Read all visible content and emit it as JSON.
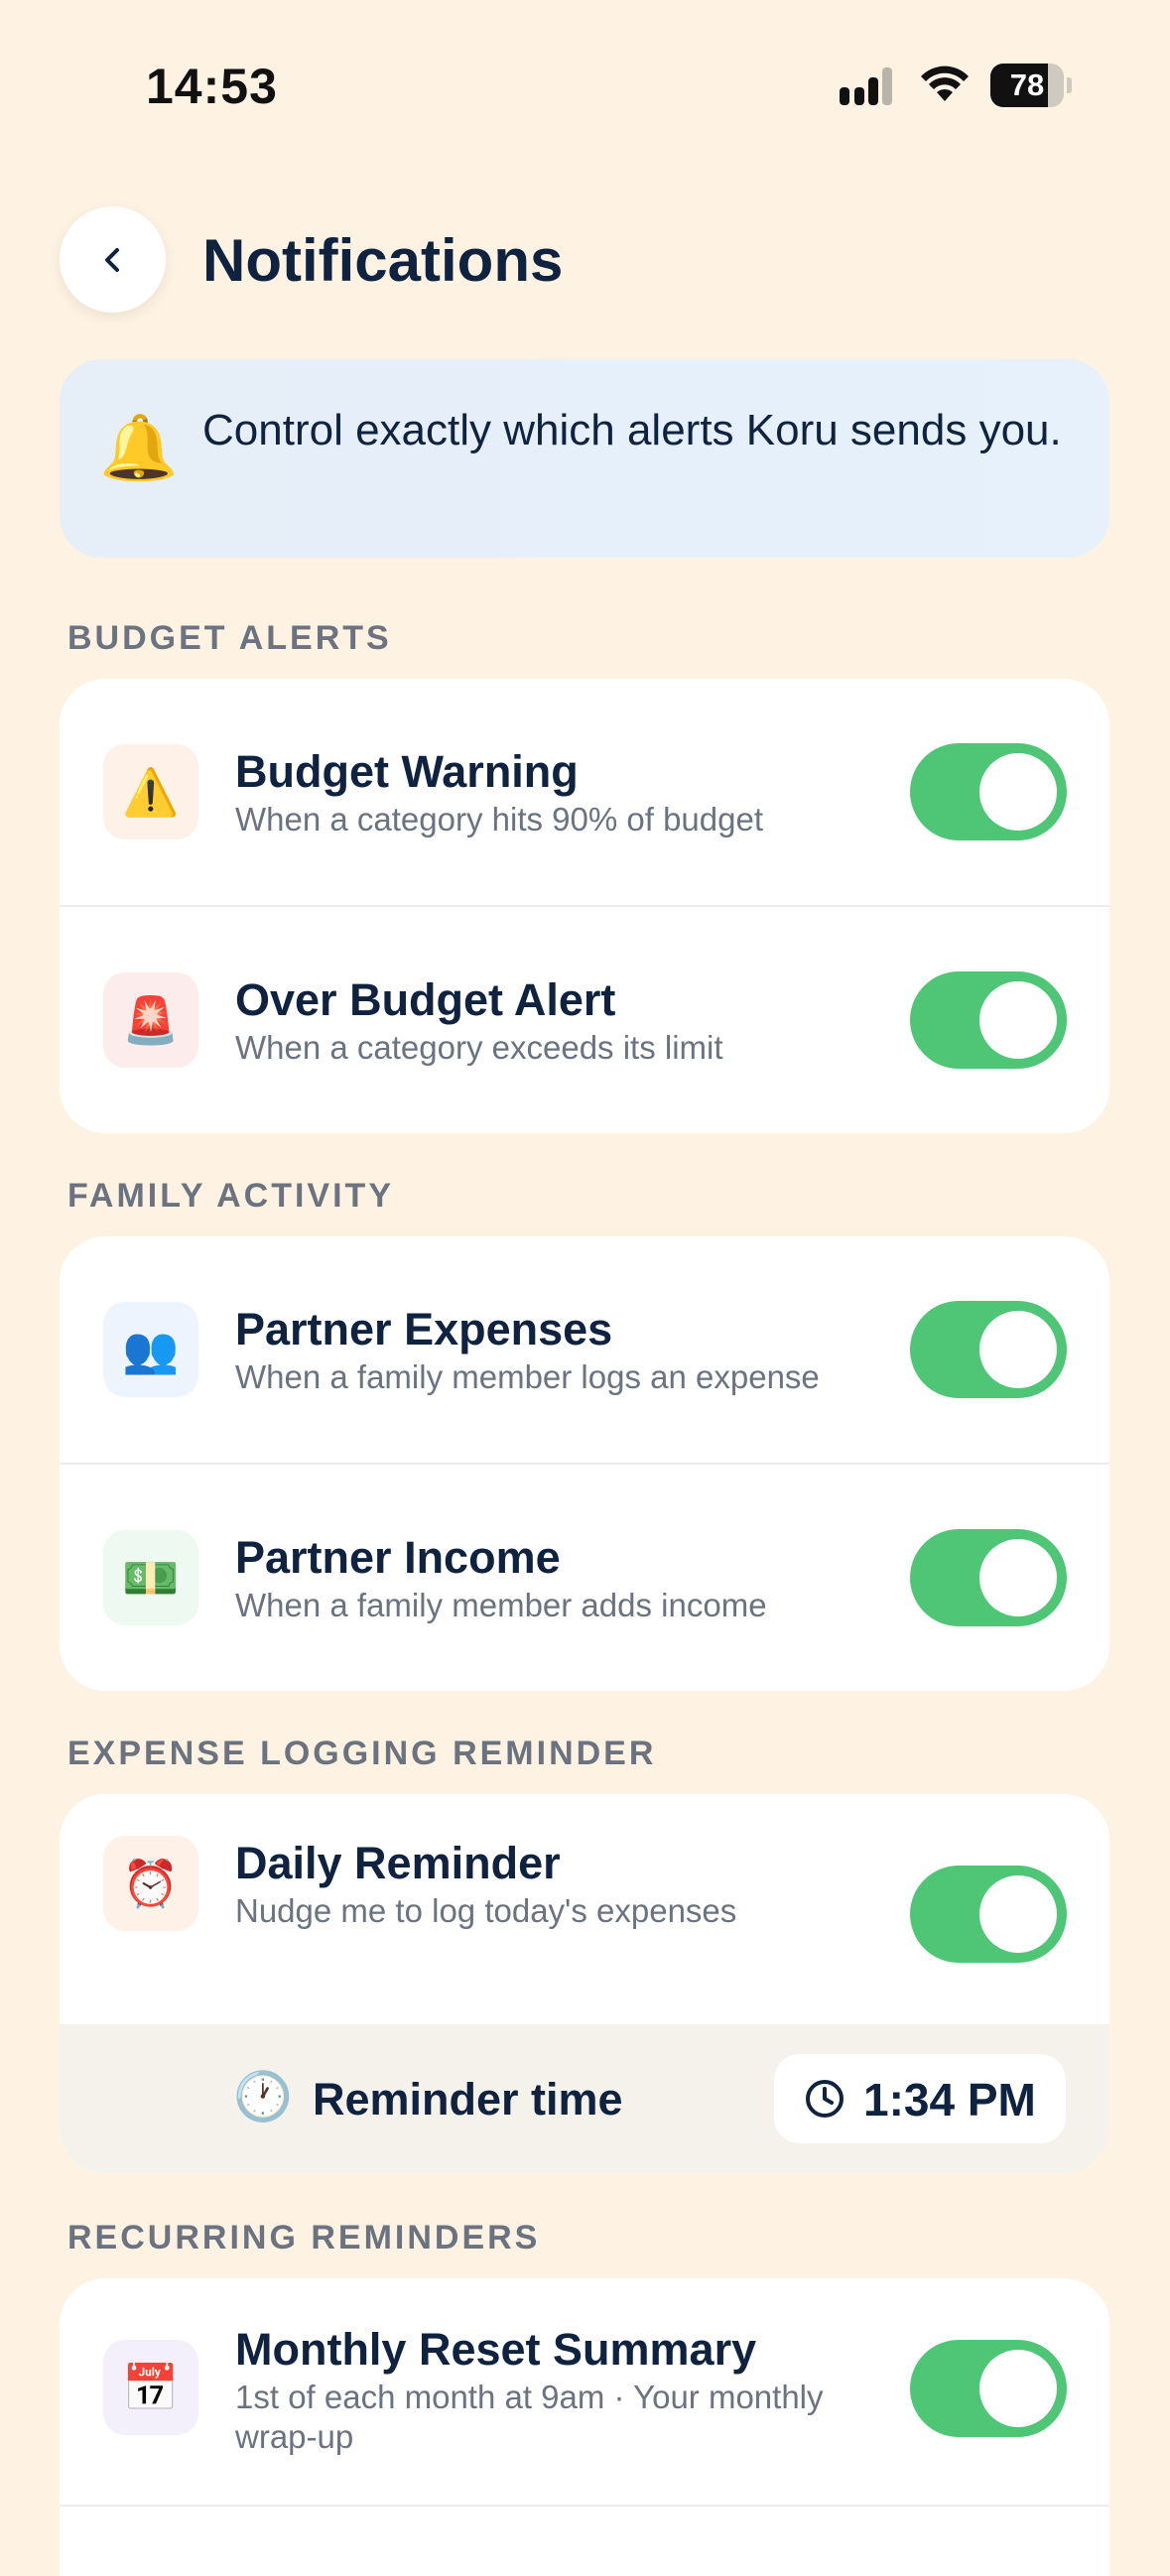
{
  "status_bar": {
    "time": "14:53",
    "battery_level": 78,
    "battery_text": "78"
  },
  "header": {
    "title": "Notifications"
  },
  "banner": {
    "icon": "bell-icon",
    "emoji": "🔔",
    "text": "Control exactly which alerts Koru sends you."
  },
  "sections": {
    "budget": {
      "label": "BUDGET ALERTS",
      "items": [
        {
          "emoji": "⚠️",
          "icon": "warning-icon",
          "icon_bg": "#FDF1E8",
          "title": "Budget Warning",
          "subtitle": "When a category hits 90% of budget",
          "enabled": true
        },
        {
          "emoji": "🚨",
          "icon": "siren-icon",
          "icon_bg": "#FDECEC",
          "title": "Over Budget Alert",
          "subtitle": "When a category exceeds its limit",
          "enabled": true
        }
      ]
    },
    "family": {
      "label": "FAMILY ACTIVITY",
      "items": [
        {
          "emoji": "👥",
          "icon": "people-icon",
          "icon_bg": "#EEF4FD",
          "title": "Partner Expenses",
          "subtitle": "When a family member logs an expense",
          "enabled": true
        },
        {
          "emoji": "💵",
          "icon": "money-icon",
          "icon_bg": "#EDF9F1",
          "title": "Partner Income",
          "subtitle": "When a family member adds income",
          "enabled": true
        }
      ]
    },
    "expense": {
      "label": "EXPENSE LOGGING REMINDER",
      "items": [
        {
          "emoji": "⏰",
          "icon": "alarm-clock-icon",
          "icon_bg": "#FDF1E8",
          "title": "Daily Reminder",
          "subtitle": "Nudge me to log today's expenses",
          "enabled": true
        }
      ],
      "reminder": {
        "emoji": "🕐",
        "label": "Reminder time",
        "value": "1:34 PM"
      }
    },
    "recurring": {
      "label": "RECURRING REMINDERS",
      "items": [
        {
          "emoji": "📅",
          "icon": "calendar-icon",
          "icon_bg": "#F3F0FB",
          "title": "Monthly Reset Summary",
          "subtitle": "1st of each month at 9am · Your monthly wrap-up",
          "enabled": true
        }
      ]
    }
  },
  "colors": {
    "background": "#FEF3E2",
    "toggle_on": "#4FC676",
    "title_text": "#0F2340",
    "muted_text": "#6B7280"
  }
}
